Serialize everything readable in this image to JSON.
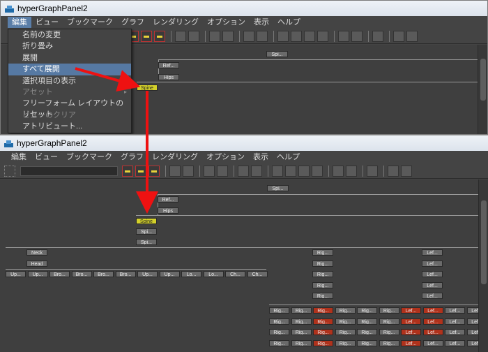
{
  "window_title": "hyperGraphPanel2",
  "menu": [
    "編集",
    "ビュー",
    "ブックマーク",
    "グラフ",
    "レンダリング",
    "オプション",
    "表示",
    "ヘルプ"
  ],
  "edit_menu_items": [
    {
      "label": "名前の変更",
      "state": "normal"
    },
    {
      "label": "折り畳み",
      "state": "normal"
    },
    {
      "label": "展開",
      "state": "normal"
    },
    {
      "label": "すべて展開",
      "state": "highlighted"
    },
    {
      "label": "選択項目の表示",
      "state": "normal"
    },
    {
      "label": "アセット",
      "state": "disabled",
      "submenu": true
    },
    {
      "label": "フリーフォーム レイアウトのリセット",
      "state": "normal"
    },
    {
      "label": "ビューのクリア",
      "state": "disabled"
    },
    {
      "label": "アトリビュート...",
      "state": "normal"
    }
  ],
  "submenu_glyph": "▸",
  "top_nodes": {
    "root": "Spi...",
    "ref": "Ref...",
    "hips": "Hips",
    "spine": "Spine"
  },
  "bottom_nodes": {
    "root": "Spi...",
    "ref": "Ref...",
    "hips": "Hips",
    "spine": "Spine",
    "spine1": "Spi...",
    "spine2": "Spi...",
    "neck": "Neck",
    "head": "Head",
    "head_children": [
      "Up...",
      "Up...",
      "Bro...",
      "Bro...",
      "Bro...",
      "Bro...",
      "Up...",
      "Up...",
      "Lo...",
      "Lo...",
      "Ch...",
      "Ch..."
    ],
    "right_column": [
      "Rig...",
      "Rig...",
      "Rig...",
      "Rig...",
      "Rig..."
    ],
    "left_column": [
      "Lef...",
      "Lef...",
      "Lef...",
      "Lef...",
      "Lef..."
    ],
    "right_fingers": "Rig...",
    "left_fingers": "Lef..."
  }
}
